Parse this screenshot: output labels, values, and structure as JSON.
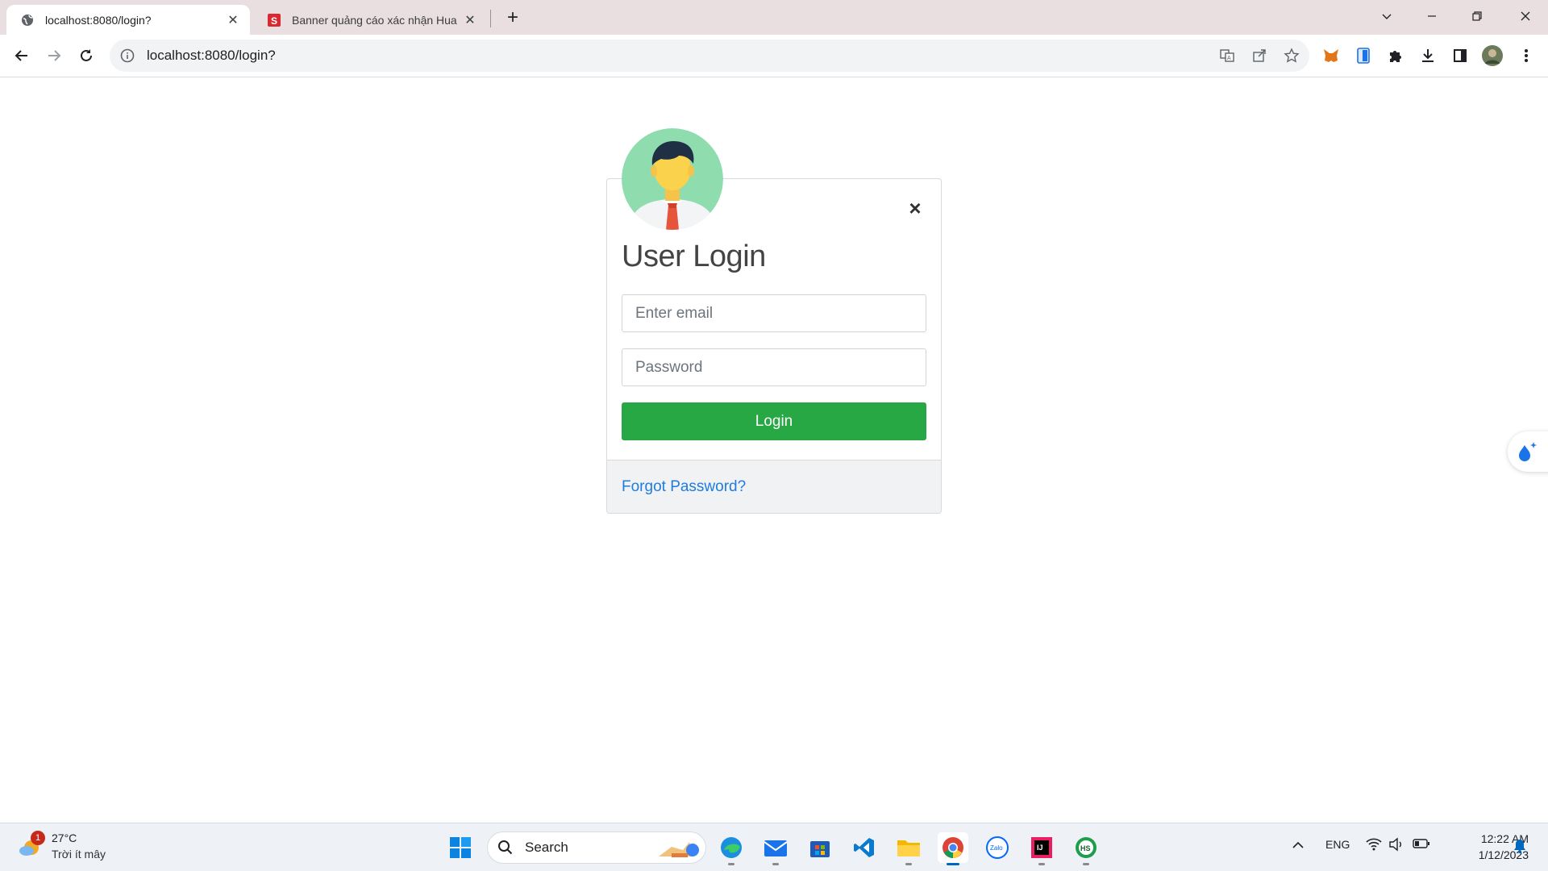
{
  "browser": {
    "tabs": [
      {
        "title": "localhost:8080/login?",
        "active": true
      },
      {
        "title": "Banner quảng cáo xác nhận Hua",
        "active": false
      }
    ],
    "url": "localhost:8080/login?"
  },
  "login": {
    "title": "User Login",
    "email_placeholder": "Enter email",
    "password_placeholder": "Password",
    "login_label": "Login",
    "forgot_label": "Forgot Password?",
    "close_glyph": "×"
  },
  "taskbar": {
    "weather": {
      "temp": "27°C",
      "condition": "Trời ít mây",
      "badge": "1"
    },
    "search_label": "Search",
    "language": "ENG",
    "time": "12:22 AM",
    "date": "1/12/2023"
  },
  "colors": {
    "login_button": "#28a745",
    "link": "#1f7ce0",
    "tab_strip": "#e9dfe0"
  }
}
